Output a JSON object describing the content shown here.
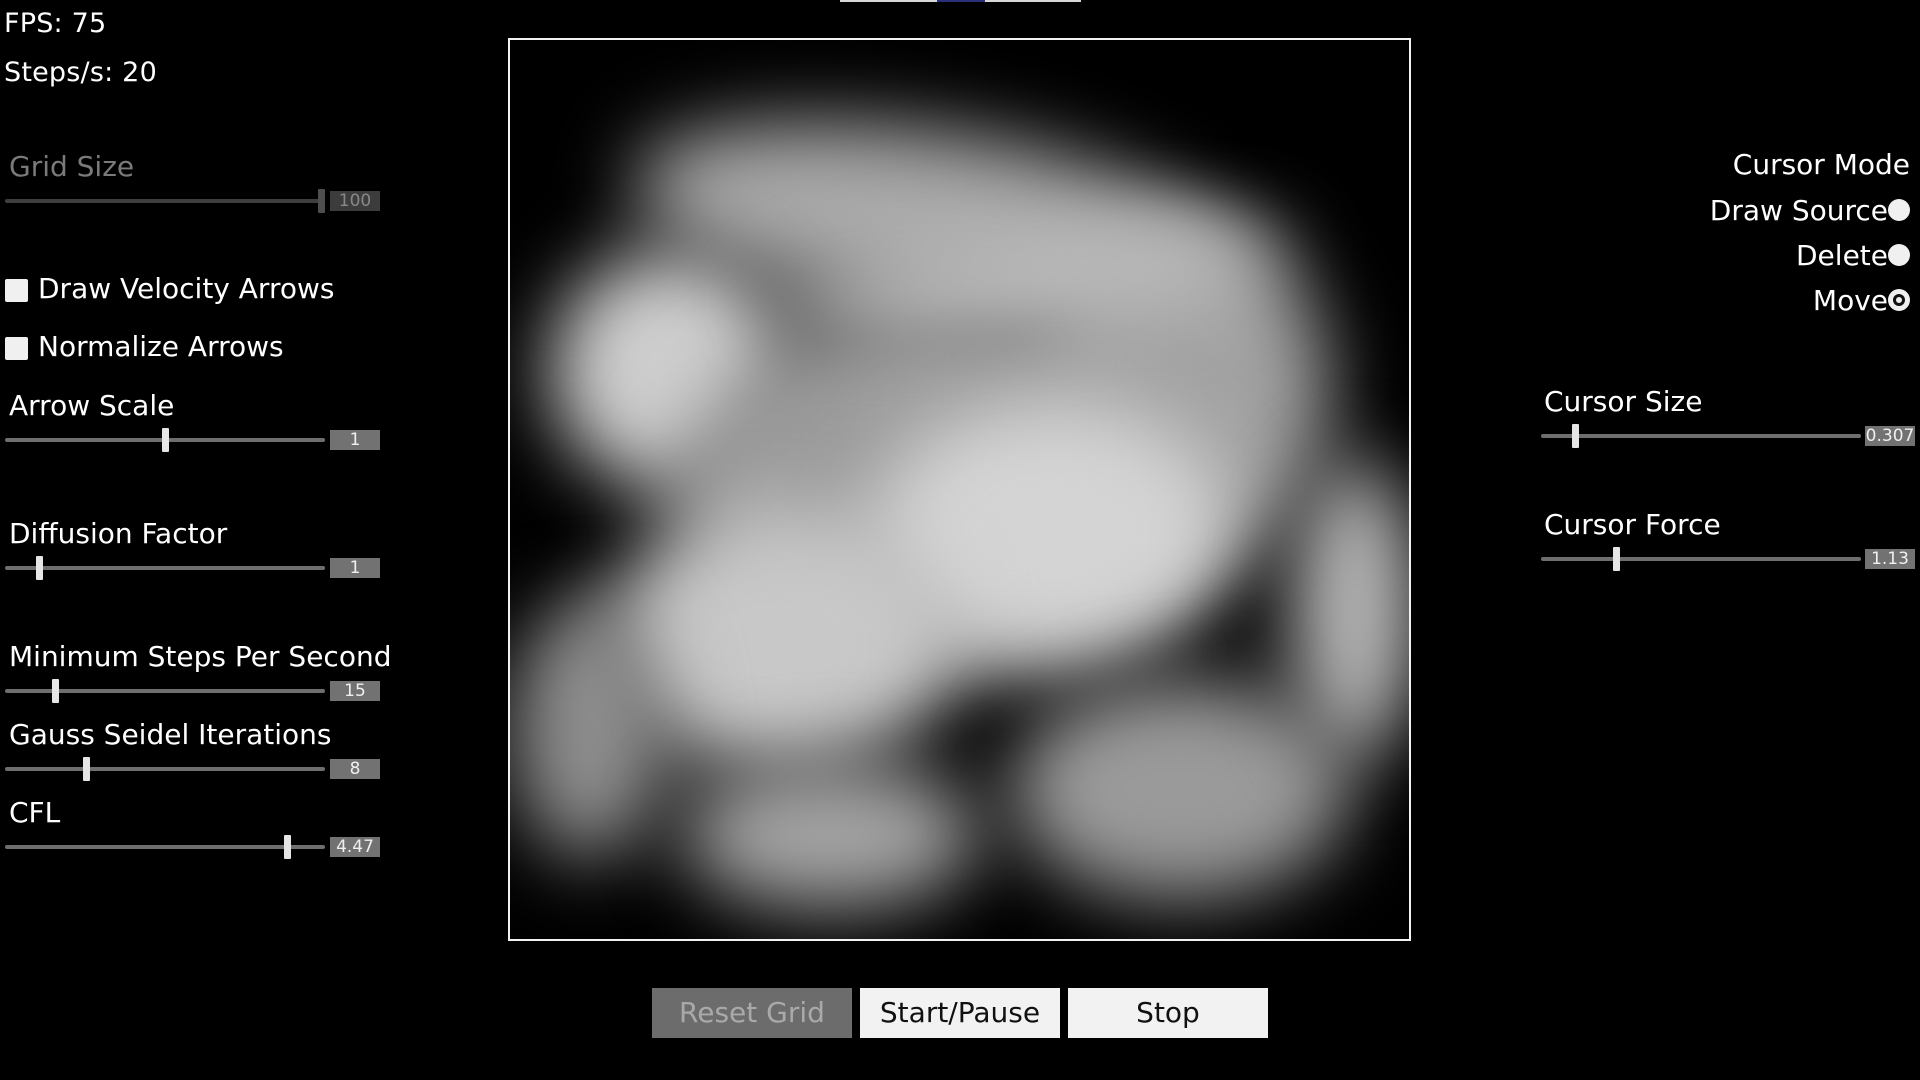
{
  "stats": {
    "fps": "FPS: 75",
    "steps": "Steps/s: 20"
  },
  "left": {
    "grid_size": {
      "label": "Grid Size",
      "value": "100",
      "fraction": 1.0,
      "disabled": true
    },
    "draw_velocity_arrows": {
      "label": "Draw Velocity Arrows",
      "checked": false
    },
    "normalize_arrows": {
      "label": "Normalize Arrows",
      "checked": false
    },
    "arrow_scale": {
      "label": "Arrow Scale",
      "value": "1",
      "fraction": 0.5
    },
    "diffusion_factor": {
      "label": "Diffusion Factor",
      "value": "1",
      "fraction": 0.1
    },
    "min_steps": {
      "label": "Minimum Steps Per Second",
      "value": "15",
      "fraction": 0.15
    },
    "gauss_seidel": {
      "label": "Gauss Seidel Iterations",
      "value": "8",
      "fraction": 0.25
    },
    "cfl": {
      "label": "CFL",
      "value": "4.47",
      "fraction": 0.89
    }
  },
  "right": {
    "cursor_mode": {
      "title": "Cursor Mode",
      "options": [
        {
          "label": "Draw Source",
          "selected": false
        },
        {
          "label": "Delete",
          "selected": false
        },
        {
          "label": "Move",
          "selected": true
        }
      ]
    },
    "cursor_size": {
      "label": "Cursor Size",
      "value": "0.307",
      "fraction": 0.1
    },
    "cursor_force": {
      "label": "Cursor Force",
      "value": "1.13",
      "fraction": 0.23
    }
  },
  "buttons": {
    "reset": "Reset Grid",
    "start_pause": "Start/Pause",
    "stop": "Stop"
  },
  "colors": {
    "background": "#000000",
    "panel_text": "#ffffff",
    "slider_track": "#6e6e6e",
    "value_box": "#727272"
  }
}
